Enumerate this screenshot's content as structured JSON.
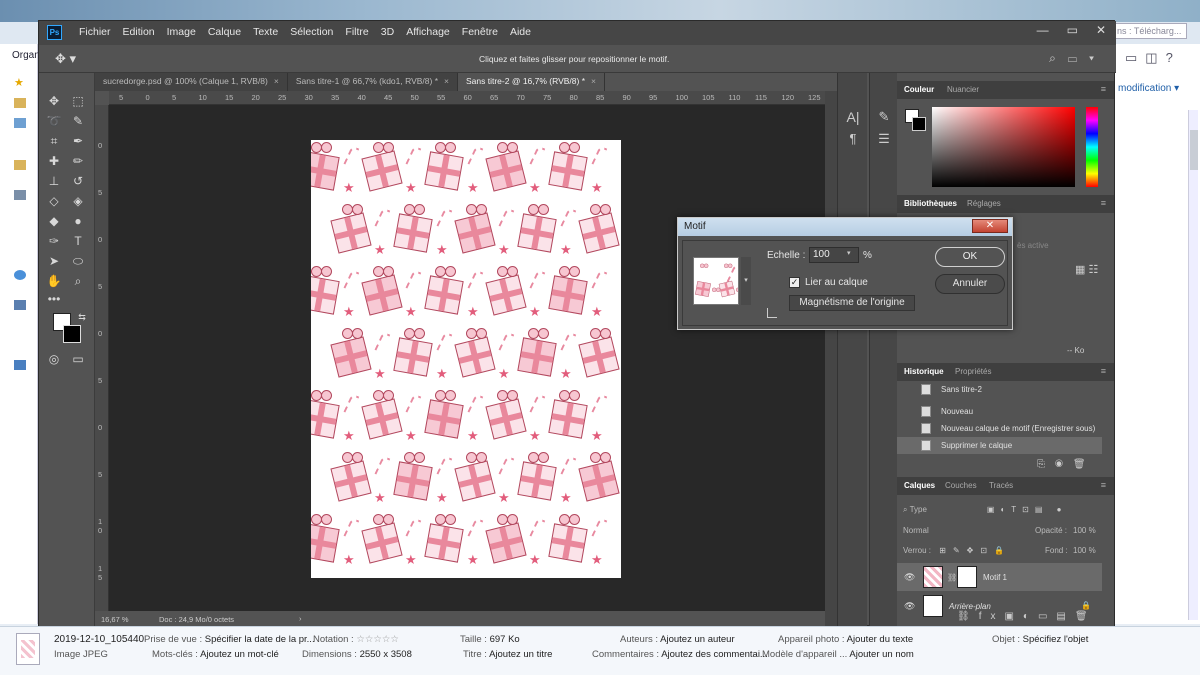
{
  "explorer": {
    "search_placeholder": "ns : Télécharg...",
    "left_label": "Organ",
    "modification": "modification"
  },
  "photoshop": {
    "logo": "Ps",
    "menus": [
      "Fichier",
      "Edition",
      "Image",
      "Calque",
      "Texte",
      "Sélection",
      "Filtre",
      "3D",
      "Affichage",
      "Fenêtre",
      "Aide"
    ],
    "window_controls": [
      "—",
      "▭",
      "✕"
    ],
    "option_hint": "Cliquez et faites glisser pour repositionner le motif.",
    "tabs": [
      {
        "label": "sucredorge.psd @ 100% (Calque 1, RVB/8)",
        "active": false
      },
      {
        "label": "Sans titre-1 @ 66,7% (kdo1, RVB/8) *",
        "active": false
      },
      {
        "label": "Sans titre-2 @ 16,7% (RVB/8) *",
        "active": true
      }
    ],
    "tab_close": "×",
    "ruler_top": [
      "5",
      "0",
      "5",
      "10",
      "15",
      "20",
      "25",
      "30",
      "35",
      "40",
      "45",
      "50",
      "55",
      "60",
      "65",
      "70",
      "75",
      "80",
      "85",
      "90",
      "95",
      "100",
      "105",
      "110",
      "115",
      "120",
      "125"
    ],
    "ruler_left": [
      "0",
      "5",
      "0",
      "5",
      "0",
      "5",
      "0",
      "5",
      "1 0",
      "1 5",
      "2 0"
    ],
    "status": {
      "zoom": "16,67 %",
      "doc": "Doc : 24,9 Mo/0 octets",
      "arrow": "›"
    }
  },
  "dialog": {
    "title": "Motif",
    "close": "✕",
    "scale_label": "Echelle :",
    "scale_value": "100",
    "percent": "%",
    "link_checked": true,
    "link_label": "Lier au calque",
    "snap_button": "Magnétisme de l'origine",
    "ok": "OK",
    "cancel": "Annuler"
  },
  "panels": {
    "color_tabs": [
      "Couleur",
      "Nuancier"
    ],
    "library_tabs": [
      "Bibliothèques",
      "Réglages"
    ],
    "library_dropdown": "ès active",
    "library_size": "-- Ko",
    "history_tabs": [
      "Historique",
      "Propriétés"
    ],
    "history_items": [
      {
        "label": "Sans titre-2",
        "selected": false
      },
      {
        "label": "Nouveau",
        "selected": false
      },
      {
        "label": "Nouveau calque de motif (Enregistrer sous)",
        "selected": false
      },
      {
        "label": "Supprimer le calque",
        "selected": true
      }
    ],
    "layers_tabs": [
      "Calques",
      "Couches",
      "Tracés"
    ],
    "layers_filter": "Type",
    "blend_mode": "Normal",
    "opacity_label": "Opacité :",
    "opacity_value": "100 %",
    "lock_label": "Verrou :",
    "fill_label": "Fond :",
    "fill_value": "100 %",
    "layers": [
      {
        "name": "Motif 1",
        "selected": true
      },
      {
        "name": "Arrière-plan",
        "selected": false
      }
    ]
  },
  "details": {
    "filename": "2019-12-10_105440",
    "filetype": "Image JPEG",
    "prise_k": "Prise de vue :",
    "prise_v": "Spécifier la date de la pr...",
    "motscles_k": "Mots-clés :",
    "motscles_v": "Ajoutez un mot-clé",
    "notation_k": "Notation :",
    "notation_v": "☆☆☆☆☆",
    "dimensions_k": "Dimensions :",
    "dimensions_v": "2550 x 3508",
    "taille_k": "Taille :",
    "taille_v": "697 Ko",
    "titre_k": "Titre :",
    "titre_v": "Ajoutez un titre",
    "auteurs_k": "Auteurs :",
    "auteurs_v": "Ajoutez un auteur",
    "comment_k": "Commentaires :",
    "comment_v": "Ajoutez des commentai...",
    "appareil_k": "Appareil photo :",
    "appareil_v": "Ajouter du texte",
    "modele_k": "Modèle d'appareil ...",
    "modele_v": "Ajouter un nom",
    "objet_k": "Objet :",
    "objet_v": "Spécifiez l'objet"
  },
  "colors": {
    "accent": "#31a8ff",
    "ps_bg": "#535353",
    "pattern_pink": "#e25d7c"
  }
}
